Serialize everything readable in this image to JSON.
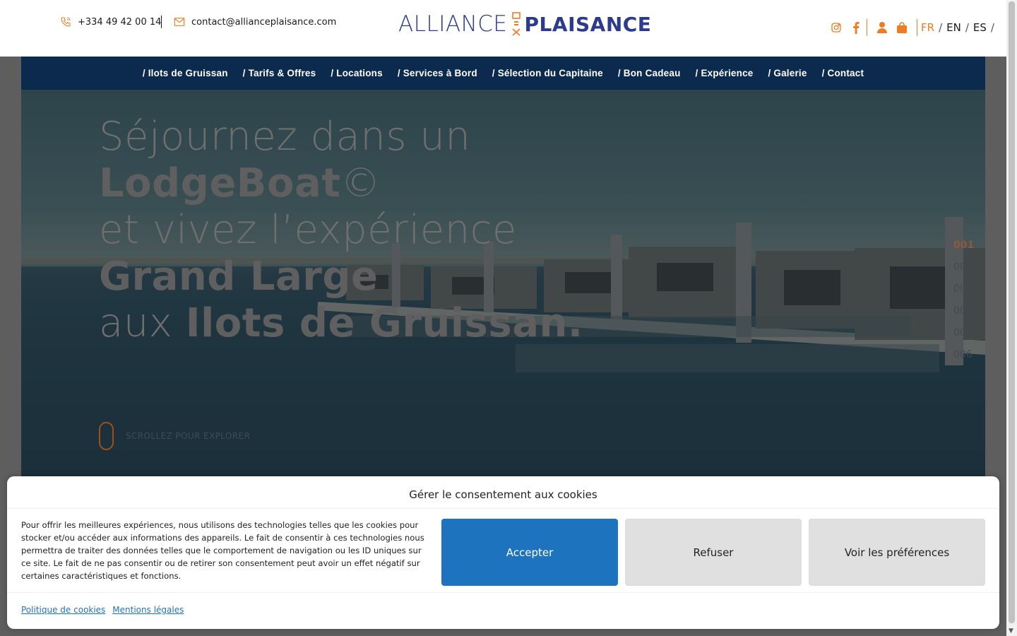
{
  "header": {
    "phone": "+334 49 42 00 14",
    "email": "contact@allianceplaisance.com",
    "logo_left": "ALLIANCE",
    "logo_right": "PLAISANCE",
    "icons": [
      "instagram-icon",
      "facebook-icon",
      "user-icon",
      "bag-icon"
    ],
    "languages": [
      "FR",
      "EN",
      "ES"
    ],
    "active_language": "FR",
    "accent_color": "#ef7b22",
    "brand_color": "#2c3b8c"
  },
  "nav": {
    "items": [
      "/ Ilots de Gruissan",
      "/ Tarifs & Offres",
      "/ Locations",
      "/ Services à Bord",
      "/ Sélection du Capitaine",
      "/ Bon Cadeau",
      "/ Expérience",
      "/ Galerie",
      "/ Contact"
    ],
    "background": "#0b2a4d"
  },
  "hero": {
    "line1": "Séjournez dans un",
    "line2_bold": "LodgeBoat",
    "line2_rest": "©",
    "line3": "et vivez l’expérience",
    "line4_bold": "Grand Large",
    "line5_light": "aux ",
    "line5_bold": "Ilots de Gruissan.",
    "slides": [
      "001",
      "002",
      "003",
      "004",
      "005",
      "006"
    ],
    "scroll_label": "SCROLLEZ POUR EXPLORER"
  },
  "cookie": {
    "title": "Gérer le consentement aux cookies",
    "text": "Pour offrir les meilleures expériences, nous utilisons des technologies telles que les cookies pour stocker et/ou accéder aux informations des appareils. Le fait de consentir à ces technologies nous permettra de traiter des données telles que le comportement de navigation ou les ID uniques sur ce site. Le fait de ne pas consentir ou de retirer son consentement peut avoir un effet négatif sur certaines caractéristiques et fonctions.",
    "accept": "Accepter",
    "refuse": "Refuser",
    "preferences": "Voir les préférences",
    "link_policy": "Politique de cookies",
    "link_legal": "Mentions légales",
    "accept_color": "#1e73be"
  }
}
